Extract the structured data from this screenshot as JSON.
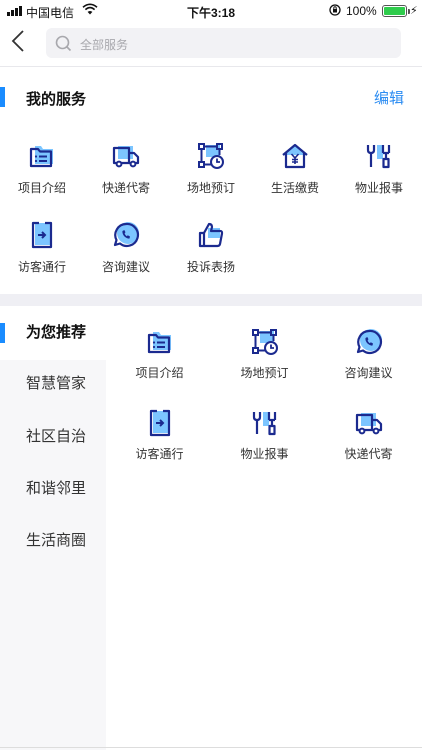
{
  "status_bar": {
    "carrier": "中国电信",
    "time": "下午3:18",
    "battery": "100%",
    "battery_level": 1.0,
    "icons": [
      "signal-icon",
      "wifi-icon",
      "rotation-lock-icon",
      "battery-icon",
      "charging-icon"
    ]
  },
  "nav": {
    "back_icon": "back-arrow-icon",
    "search_placeholder": "全部服务",
    "search_icon": "search-icon"
  },
  "my_services": {
    "title": "我的服务",
    "edit_label": "编辑",
    "items": [
      {
        "label": "项目介绍",
        "icon": "folder-list-icon"
      },
      {
        "label": "快递代寄",
        "icon": "delivery-truck-icon"
      },
      {
        "label": "场地预订",
        "icon": "venue-booking-icon"
      },
      {
        "label": "生活缴费",
        "icon": "house-yen-icon"
      },
      {
        "label": "物业报事",
        "icon": "tools-icon"
      },
      {
        "label": "访客通行",
        "icon": "visitor-pass-icon"
      },
      {
        "label": "咨询建议",
        "icon": "chat-phone-icon"
      },
      {
        "label": "投诉表扬",
        "icon": "thumbs-up-icon"
      }
    ]
  },
  "categories": [
    {
      "label": "为您推荐",
      "active": true
    },
    {
      "label": "智慧管家",
      "active": false
    },
    {
      "label": "社区自治",
      "active": false
    },
    {
      "label": "和谐邻里",
      "active": false
    },
    {
      "label": "生活商圈",
      "active": false
    }
  ],
  "recommended": [
    {
      "label": "项目介绍",
      "icon": "folder-list-icon"
    },
    {
      "label": "场地预订",
      "icon": "venue-booking-icon"
    },
    {
      "label": "咨询建议",
      "icon": "chat-phone-icon"
    },
    {
      "label": "访客通行",
      "icon": "visitor-pass-icon"
    },
    {
      "label": "物业报事",
      "icon": "tools-icon"
    },
    {
      "label": "快递代寄",
      "icon": "delivery-truck-icon"
    }
  ],
  "colors": {
    "accent": "#1a8cff",
    "icon_stroke": "#1b2a8f",
    "icon_fill": "#7cc5ff",
    "edit_text": "#2b8cf2"
  }
}
